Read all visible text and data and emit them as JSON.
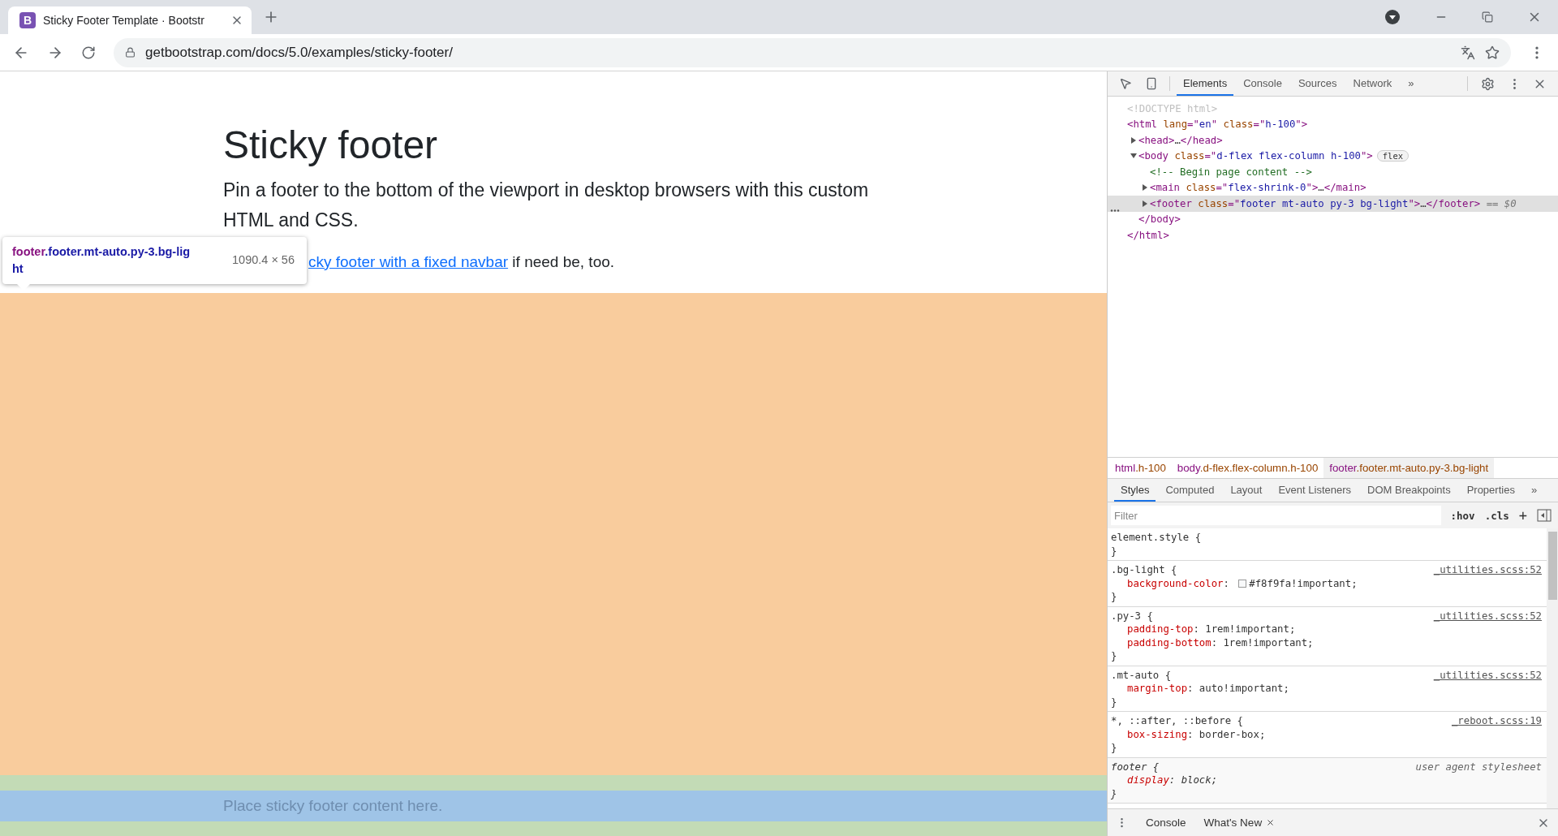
{
  "browser": {
    "tab": {
      "favicon": "B",
      "title": "Sticky Footer Template · Bootstr"
    },
    "url": "getbootstrap.com/docs/5.0/examples/sticky-footer/"
  },
  "page": {
    "heading": "Sticky footer",
    "lead": "Pin a footer to the bottom of the viewport in desktop browsers with this custom HTML and CSS.",
    "link": "cky footer with a fixed navbar",
    "after_link": " if need be, too.",
    "footer_text": "Place sticky footer content here.",
    "tooltip": {
      "tag": "footer",
      "classes": ".footer.mt-auto.py-3.bg-lig",
      "wrap": "ht",
      "size": "1090.4 × 56"
    }
  },
  "devtools": {
    "tabs": [
      {
        "label": "Elements",
        "selected": true
      },
      {
        "label": "Console",
        "selected": false
      },
      {
        "label": "Sources",
        "selected": false
      },
      {
        "label": "Network",
        "selected": false
      }
    ],
    "more": "»",
    "dom": [
      {
        "selected": false,
        "segments": [
          {
            "doctype": "<!DOCTYPE html>"
          }
        ]
      },
      {
        "selected": false,
        "segments": [
          {
            "tag": "<html "
          },
          {
            "attr": "lang"
          },
          {
            "punct": "=\""
          },
          {
            "value": "en"
          },
          {
            "punct": "\" "
          },
          {
            "attr": "class"
          },
          {
            "punct": "=\""
          },
          {
            "value": "h-100"
          },
          {
            "punct": "\""
          },
          {
            "tag": ">"
          }
        ],
        "children": [
          {
            "selected": false,
            "expanded": false,
            "segments": [
              {
                "tag": "<head>"
              },
              {
                "plain": "…"
              },
              {
                "tag": "</head>"
              }
            ]
          },
          {
            "selected": false,
            "expanded": true,
            "badge": "flex",
            "segments": [
              {
                "tag": "<body "
              },
              {
                "attr": "class"
              },
              {
                "punct": "=\""
              },
              {
                "value": "d-flex flex-column h-100"
              },
              {
                "punct": "\""
              },
              {
                "tag": ">"
              }
            ],
            "children": [
              {
                "selected": false,
                "segments": [
                  {
                    "comment": "<!-- Begin page content -->"
                  }
                ]
              },
              {
                "selected": false,
                "expanded": false,
                "segments": [
                  {
                    "tag": "<main "
                  },
                  {
                    "attr": "class"
                  },
                  {
                    "punct": "=\""
                  },
                  {
                    "value": "flex-shrink-0"
                  },
                  {
                    "punct": "\""
                  },
                  {
                    "tag": ">"
                  },
                  {
                    "plain": "…"
                  },
                  {
                    "tag": "</main>"
                  }
                ]
              },
              {
                "selected": true,
                "expanded": false,
                "suffix": " == $0",
                "segments": [
                  {
                    "tag": "<footer "
                  },
                  {
                    "attr": "class"
                  },
                  {
                    "punct": "=\""
                  },
                  {
                    "value": "footer mt-auto py-3 bg-light"
                  },
                  {
                    "punct": "\""
                  },
                  {
                    "tag": ">"
                  },
                  {
                    "plain": "…"
                  },
                  {
                    "tag": "</footer>"
                  }
                ]
              }
            ],
            "close": "</body>"
          }
        ],
        "close": "</html>"
      }
    ],
    "breadcrumbs": [
      {
        "tag": "html",
        "classes": ".h-100",
        "selected": false
      },
      {
        "tag": "body",
        "classes": ".d-flex.flex-column.h-100",
        "selected": false
      },
      {
        "tag": "footer",
        "classes": ".footer.mt-auto.py-3.bg-light",
        "selected": true
      }
    ],
    "style_tabs": [
      {
        "label": "Styles",
        "selected": true
      },
      {
        "label": "Computed",
        "selected": false
      },
      {
        "label": "Layout",
        "selected": false
      },
      {
        "label": "Event Listeners",
        "selected": false
      },
      {
        "label": "DOM Breakpoints",
        "selected": false
      },
      {
        "label": "Properties",
        "selected": false
      }
    ],
    "filter": {
      "placeholder": "Filter"
    },
    "hov": ":hov",
    "cls": ".cls",
    "plus": "+",
    "rules": [
      {
        "kind": "author",
        "selector": "element.style {",
        "close": "}"
      },
      {
        "kind": "author",
        "selector": ".bg-light {",
        "source": "_utilities.scss:52",
        "props": [
          {
            "name": "background-color",
            "colon": ":",
            "value": "#f8f9fa!important;",
            "color": "#f8f9fa"
          }
        ],
        "close": "}"
      },
      {
        "kind": "author",
        "selector": ".py-3 {",
        "source": "_utilities.scss:52",
        "props": [
          {
            "name": "padding-top",
            "colon": ":",
            "value": "1rem!important;"
          },
          {
            "name": "padding-bottom",
            "colon": ":",
            "value": "1rem!important;"
          }
        ],
        "close": "}"
      },
      {
        "kind": "author",
        "selector": ".mt-auto {",
        "source": "_utilities.scss:52",
        "props": [
          {
            "name": "margin-top",
            "colon": ":",
            "value": "auto!important;"
          }
        ],
        "close": "}"
      },
      {
        "kind": "author",
        "selector": "*, ::after, ::before {",
        "source": "_reboot.scss:19",
        "props": [
          {
            "name": "box-sizing",
            "colon": ":",
            "value": "border-box;"
          }
        ],
        "close": "}"
      },
      {
        "kind": "ua",
        "selector": "footer {",
        "source": "user agent stylesheet",
        "props": [
          {
            "name": "display",
            "colon": ":",
            "value": "block;"
          }
        ],
        "close": "}"
      }
    ],
    "drawer": [
      {
        "label": "Console",
        "closable": false
      },
      {
        "label": "What's New",
        "closable": true
      }
    ]
  }
}
